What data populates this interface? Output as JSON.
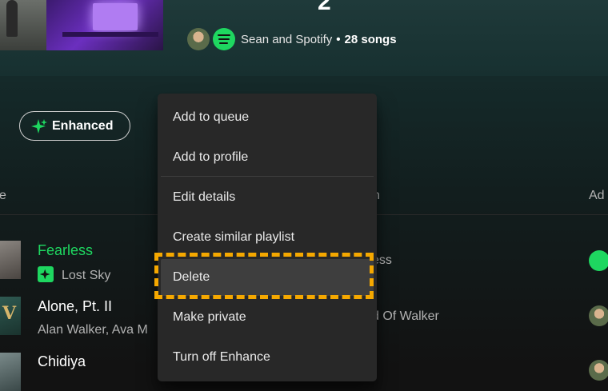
{
  "header": {
    "title_fragment": "2",
    "owner": "Sean and Spotify",
    "separator": "•",
    "song_count": "28 songs"
  },
  "enhanced_button": {
    "label": "Enhanced",
    "icon": "sparkle-icon"
  },
  "columns": {
    "title": "e",
    "album": "n",
    "date_added": "Ad"
  },
  "tracks": [
    {
      "title": "Fearless",
      "artist": "Lost Sky",
      "album": "ess",
      "playing": true,
      "enhanced": true
    },
    {
      "title": "Alone, Pt. II",
      "artist": "Alan Walker, Ava M",
      "album": "d Of Walker"
    },
    {
      "title": "Chidiya"
    }
  ],
  "context_menu": {
    "items": [
      "Add to queue",
      "Add to profile",
      "Edit details",
      "Create similar playlist",
      "Delete",
      "Make private",
      "Turn off Enhance"
    ],
    "hovered": "Delete"
  },
  "colors": {
    "accent": "#1ed760",
    "highlight": "#f5a800",
    "menu_bg": "#282828"
  }
}
